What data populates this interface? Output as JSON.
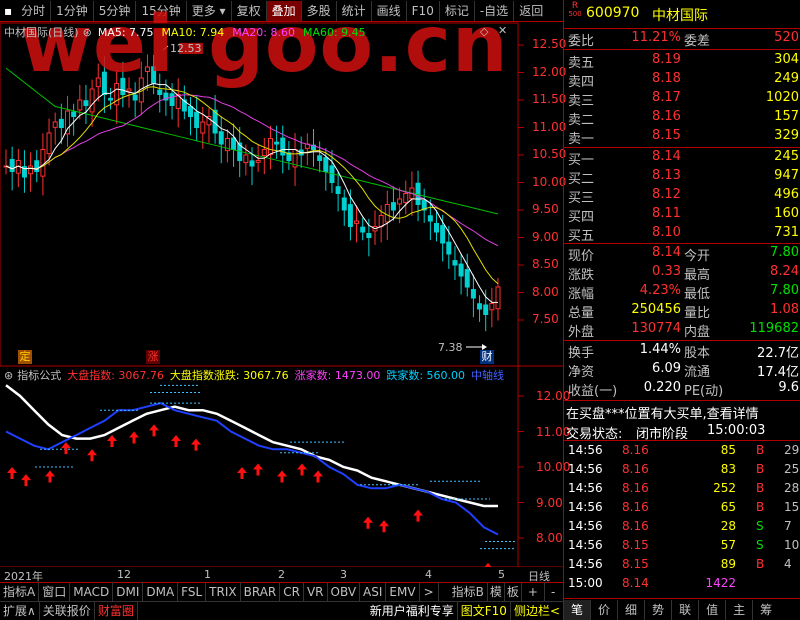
{
  "toolbar": {
    "items": [
      "分时",
      "1分钟",
      "5分钟",
      "15分钟",
      "更多",
      "复权",
      "叠加",
      "多股",
      "统计",
      "画线",
      "F10",
      "标记",
      "-自选",
      "返回"
    ],
    "active_index": 6
  },
  "watermark": "wei-goo.cn",
  "chart": {
    "title": "中材国际(日线)",
    "ma": [
      {
        "label": "MA5: 7.75",
        "color": "#ffffff"
      },
      {
        "label": "MA10: 7.94",
        "color": "#ffff00"
      },
      {
        "label": "MA20: 8.60",
        "color": "#ff40ff"
      },
      {
        "label": "MA60: 9.45",
        "color": "#00e000"
      }
    ],
    "price_ticks": [
      "12.50",
      "12.00",
      "11.50",
      "11.00",
      "10.50",
      "10.00",
      "9.50",
      "9.00",
      "8.50",
      "8.00",
      "7.50"
    ],
    "high_label": "12.53",
    "low_label": "7.38",
    "markers": {
      "ding": "定",
      "zhang": "涨",
      "cai": "财"
    }
  },
  "indicator": {
    "name": "指标公式",
    "items": [
      {
        "label": "大盘指数: 3067.76",
        "color": "#ff3030"
      },
      {
        "label": "大盘指数涨跌: 3067.76",
        "color": "#ffff00"
      },
      {
        "label": "涨家数: 1473.00",
        "color": "#ff40ff"
      },
      {
        "label": "跌家数: 560.00",
        "color": "#00d0ff"
      },
      {
        "label": "中轴线",
        "color": "#4060ff"
      }
    ],
    "ticks": [
      "12.00",
      "11.00",
      "10.00",
      "9.00",
      "8.00"
    ]
  },
  "xaxis": {
    "labels": [
      "2021年",
      "12",
      "1",
      "2",
      "3",
      "4",
      "5"
    ],
    "period": "日线"
  },
  "bottom_tabs": [
    "指标A",
    "窗口",
    "MACD",
    "DMI",
    "DMA",
    "FSL",
    "TRIX",
    "BRAR",
    "CR",
    "VR",
    "OBV",
    "ASI",
    "EMV",
    ">",
    "指标B",
    "模",
    "板",
    "+",
    "-"
  ],
  "status_bar": {
    "left": [
      "扩展∧",
      "关联报价",
      "财富圈"
    ],
    "right": [
      "新用户福利专享",
      "图文F10",
      "侧边栏<"
    ]
  },
  "quote": {
    "code": "600970",
    "name": "中材国际",
    "r_badge": "R",
    "r_num": "500",
    "weibi_label": "委比",
    "weibi": "11.21%",
    "weicha_label": "委差",
    "weicha": "520",
    "asks": [
      {
        "label": "卖五",
        "price": "8.19",
        "vol": "304"
      },
      {
        "label": "卖四",
        "price": "8.18",
        "vol": "249"
      },
      {
        "label": "卖三",
        "price": "8.17",
        "vol": "1020"
      },
      {
        "label": "卖二",
        "price": "8.16",
        "vol": "157"
      },
      {
        "label": "卖一",
        "price": "8.15",
        "vol": "329"
      }
    ],
    "bids": [
      {
        "label": "买一",
        "price": "8.14",
        "vol": "245"
      },
      {
        "label": "买二",
        "price": "8.13",
        "vol": "947"
      },
      {
        "label": "买三",
        "price": "8.12",
        "vol": "496"
      },
      {
        "label": "买四",
        "price": "8.11",
        "vol": "160"
      },
      {
        "label": "买五",
        "price": "8.10",
        "vol": "731"
      }
    ],
    "stats": [
      {
        "l1": "现价",
        "v1": "8.14",
        "c1": "#ff3030",
        "l2": "今开",
        "v2": "7.80",
        "c2": "#00e000"
      },
      {
        "l1": "涨跌",
        "v1": "0.33",
        "c1": "#ff3030",
        "l2": "最高",
        "v2": "8.24",
        "c2": "#ff3030"
      },
      {
        "l1": "涨幅",
        "v1": "4.23%",
        "c1": "#ff3030",
        "l2": "最低",
        "v2": "7.80",
        "c2": "#00e000"
      },
      {
        "l1": "总量",
        "v1": "250456",
        "c1": "#ffff00",
        "l2": "量比",
        "v2": "1.08",
        "c2": "#ff3030"
      },
      {
        "l1": "外盘",
        "v1": "130774",
        "c1": "#ff3030",
        "l2": "内盘",
        "v2": "119682",
        "c2": "#00e000"
      }
    ],
    "stats2": [
      {
        "l1": "换手",
        "v1": "1.44%",
        "l2": "股本",
        "v2": "22.7亿"
      },
      {
        "l1": "净资",
        "v1": "6.09",
        "l2": "流通",
        "v2": "17.4亿"
      },
      {
        "l1": "收益(一)",
        "v1": "0.220",
        "l2": "PE(动)",
        "v2": "9.6"
      }
    ],
    "notice": "在买盘***位置有大买单,查看详情",
    "trade_status_label": "交易状态:",
    "trade_status": "闭市阶段",
    "trade_time": "15:00:03",
    "ticks": [
      {
        "t": "14:56",
        "p": "8.16",
        "v": "85",
        "s": "B",
        "n": "29"
      },
      {
        "t": "14:56",
        "p": "8.16",
        "v": "83",
        "s": "B",
        "n": "25"
      },
      {
        "t": "14:56",
        "p": "8.16",
        "v": "252",
        "s": "B",
        "n": "28"
      },
      {
        "t": "14:56",
        "p": "8.16",
        "v": "65",
        "s": "B",
        "n": "15"
      },
      {
        "t": "14:56",
        "p": "8.16",
        "v": "28",
        "s": "S",
        "n": "7"
      },
      {
        "t": "14:56",
        "p": "8.15",
        "v": "57",
        "s": "S",
        "n": "10"
      },
      {
        "t": "14:56",
        "p": "8.15",
        "v": "89",
        "s": "B",
        "n": "4"
      },
      {
        "t": "15:00",
        "p": "8.14",
        "v": "1422",
        "s": "",
        "n": ""
      }
    ],
    "bottom_tabs": [
      "笔",
      "价",
      "细",
      "势",
      "联",
      "值",
      "主",
      "筹"
    ]
  }
}
